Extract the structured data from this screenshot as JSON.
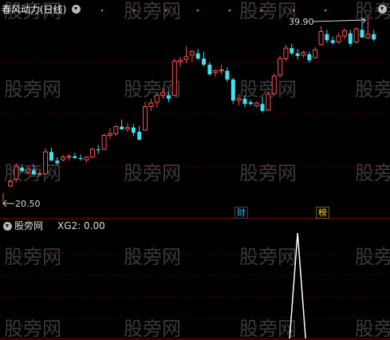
{
  "watermark": {
    "text": "股旁网",
    "color": "#3a3a3a"
  },
  "main_panel": {
    "title": "春风动力(日线)",
    "title_color": "#ffffff",
    "high_label": "39.90",
    "low_label": "20.50",
    "marker_cai": "财",
    "marker_bang": "榜"
  },
  "sub_panel": {
    "title": "股旁网",
    "indicator": "XG2: 0.00"
  },
  "colors": {
    "up": "#ff5050",
    "down": "#40e0f0",
    "flat": "#ffffff",
    "grid": "#7a0000",
    "dot": "#c050c0",
    "indicator_line": "#ffffff"
  },
  "chart_data": [
    {
      "type": "candlestick",
      "title": "春风动力(日线)",
      "annotations": [
        "39.90",
        "20.50",
        "财",
        "榜"
      ],
      "ohlc": [
        [
          21.6,
          22.3,
          21.5,
          22.1
        ],
        [
          22.4,
          24.2,
          22.0,
          23.8
        ],
        [
          23.7,
          24.1,
          23.1,
          23.3
        ],
        [
          23.2,
          23.8,
          22.9,
          23.5
        ],
        [
          23.4,
          24.0,
          23.0,
          22.9
        ],
        [
          22.9,
          23.3,
          22.7,
          23.0
        ],
        [
          23.0,
          25.9,
          22.9,
          25.5
        ],
        [
          25.5,
          26.0,
          25.0,
          24.5
        ],
        [
          24.5,
          24.9,
          24.0,
          24.2
        ],
        [
          24.6,
          25.2,
          24.4,
          24.9
        ],
        [
          24.9,
          25.3,
          24.5,
          25.0
        ],
        [
          25.0,
          25.4,
          24.7,
          24.8
        ],
        [
          24.8,
          25.2,
          24.5,
          24.7
        ],
        [
          24.6,
          25.0,
          24.3,
          24.9
        ],
        [
          24.9,
          26.0,
          24.8,
          25.8
        ],
        [
          25.8,
          26.3,
          25.3,
          25.7
        ],
        [
          25.8,
          27.6,
          25.7,
          27.4
        ],
        [
          27.4,
          28.2,
          27.0,
          27.6
        ],
        [
          27.6,
          28.6,
          27.3,
          28.4
        ],
        [
          28.4,
          29.2,
          28.0,
          28.1
        ],
        [
          28.1,
          28.8,
          27.8,
          28.3
        ],
        [
          28.3,
          28.7,
          27.3,
          27.7
        ],
        [
          27.8,
          28.5,
          26.8,
          26.9
        ],
        [
          28.0,
          31.2,
          27.9,
          30.7
        ],
        [
          30.7,
          31.6,
          30.2,
          31.1
        ],
        [
          31.2,
          32.2,
          30.6,
          32.0
        ],
        [
          32.0,
          32.9,
          31.6,
          32.3
        ],
        [
          32.0,
          32.4,
          31.2,
          31.6
        ],
        [
          32.0,
          36.2,
          31.9,
          35.9
        ],
        [
          35.8,
          36.4,
          35.3,
          36.0
        ],
        [
          36.1,
          37.6,
          35.7,
          36.4
        ],
        [
          36.6,
          37.2,
          35.8,
          37.0
        ],
        [
          36.8,
          37.3,
          36.0,
          36.2
        ],
        [
          36.2,
          37.0,
          35.3,
          35.5
        ],
        [
          35.5,
          35.8,
          34.2,
          34.4
        ],
        [
          34.6,
          35.0,
          34.1,
          34.8
        ],
        [
          34.8,
          35.5,
          34.4,
          34.9
        ],
        [
          34.8,
          35.2,
          33.5,
          33.8
        ],
        [
          33.8,
          34.0,
          31.0,
          31.4
        ],
        [
          31.4,
          32.1,
          30.8,
          31.6
        ],
        [
          31.6,
          32.0,
          30.6,
          31.0
        ],
        [
          31.2,
          31.5,
          30.8,
          31.0
        ],
        [
          30.8,
          31.3,
          30.6,
          31.1
        ],
        [
          31.0,
          31.8,
          30.0,
          30.2
        ],
        [
          30.3,
          32.4,
          30.2,
          32.1
        ],
        [
          32.2,
          34.5,
          32.0,
          34.2
        ],
        [
          34.3,
          36.5,
          34.0,
          36.2
        ],
        [
          36.2,
          37.8,
          35.9,
          37.4
        ],
        [
          37.4,
          37.9,
          36.6,
          36.8
        ],
        [
          36.8,
          37.3,
          36.1,
          36.5
        ],
        [
          36.6,
          37.1,
          36.3,
          36.9
        ],
        [
          36.7,
          37.0,
          35.7,
          36.0
        ],
        [
          36.3,
          37.5,
          36.2,
          37.2
        ],
        [
          37.8,
          39.9,
          37.7,
          39.3
        ],
        [
          39.0,
          39.5,
          38.0,
          38.3
        ],
        [
          38.3,
          38.7,
          37.8,
          38.0
        ],
        [
          38.1,
          39.2,
          37.9,
          38.8
        ],
        [
          38.8,
          39.6,
          38.4,
          39.4
        ],
        [
          39.1,
          39.5,
          37.6,
          37.9
        ],
        [
          38.1,
          39.8,
          37.9,
          39.6
        ],
        [
          39.5,
          40.6,
          39.2,
          38.6
        ],
        [
          38.6,
          40.9,
          38.4,
          39.0
        ],
        [
          39.0,
          39.5,
          38.2,
          38.4
        ]
      ],
      "indicator": {
        "name": "XG2",
        "value": 0.0,
        "signal_index": 49
      }
    }
  ]
}
